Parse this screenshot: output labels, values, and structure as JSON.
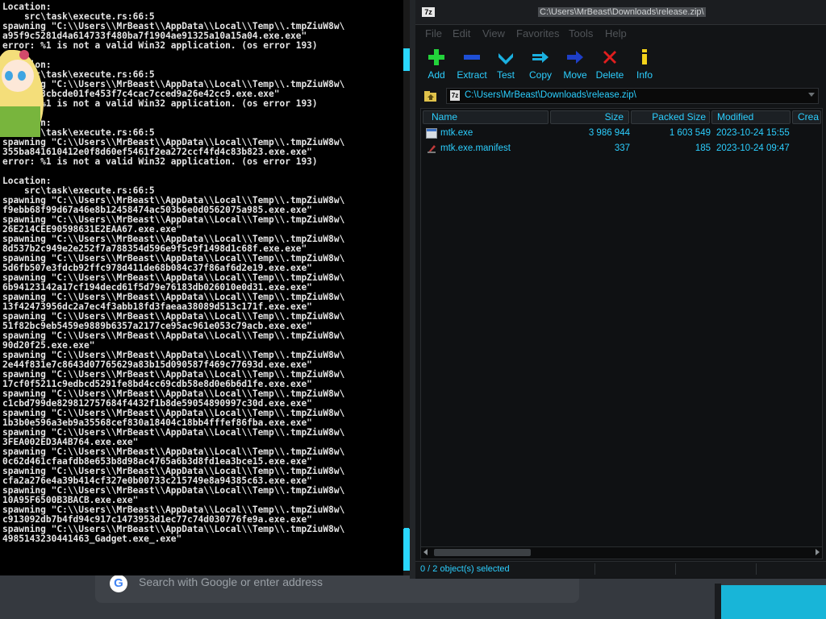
{
  "browser": {
    "search_placeholder": "Search with Google or enter address",
    "google_letter": "G"
  },
  "console": {
    "lines": [
      "Location:",
      "    src\\task\\execute.rs:66:5",
      "spawning \"C:\\\\Users\\\\MrBeast\\\\AppData\\\\Local\\\\Temp\\\\.tmpZiuW8w\\",
      "a95f9c5281d4a614733f480ba7f1904ae91325a10a15a04.exe.exe\"",
      "error: %1 is not a valid Win32 application. (os error 193)",
      "",
      "Location:",
      "    src\\task\\execute.rs:66:5",
      "spawning \"C:\\\\Users\\\\MrBeast\\\\AppData\\\\Local\\\\Temp\\\\.tmpZiuW8w\\",
      "b725a1c8cbcde01fe453f7c4cac7cced9a26e42cc9.exe.exe\"",
      "error: %1 is not a valid Win32 application. (os error 193)",
      "",
      "Location:",
      "    src\\task\\execute.rs:66:5",
      "spawning \"C:\\\\Users\\\\MrBeast\\\\AppData\\\\Local\\\\Temp\\\\.tmpZiuW8w\\",
      "355ba841610412e0f8d60ef5461f2ea272ccf4fd4c83b823.exe.exe\"",
      "error: %1 is not a valid Win32 application. (os error 193)",
      "",
      "Location:",
      "    src\\task\\execute.rs:66:5",
      "spawning \"C:\\\\Users\\\\MrBeast\\\\AppData\\\\Local\\\\Temp\\\\.tmpZiuW8w\\",
      "f9ebb68f99d67a46e8b12458474ac503b6e0d0562075a985.exe.exe\"",
      "spawning \"C:\\\\Users\\\\MrBeast\\\\AppData\\\\Local\\\\Temp\\\\.tmpZiuW8w\\",
      "26E214CEE90598631E2EAA67.exe.exe\"",
      "spawning \"C:\\\\Users\\\\MrBeast\\\\AppData\\\\Local\\\\Temp\\\\.tmpZiuW8w\\",
      "8d537b2c949e2e252f7a788354d596e9f5c9f1498d1c68f.exe.exe\"",
      "spawning \"C:\\\\Users\\\\MrBeast\\\\AppData\\\\Local\\\\Temp\\\\.tmpZiuW8w\\",
      "5d6fb507e3fdcb92ffc978d411de68b084c37f86af6d2e19.exe.exe\"",
      "spawning \"C:\\\\Users\\\\MrBeast\\\\AppData\\\\Local\\\\Temp\\\\.tmpZiuW8w\\",
      "6b94123142a17cf194decd61f5d79e76183db026010e0d31.exe.exe\"",
      "spawning \"C:\\\\Users\\\\MrBeast\\\\AppData\\\\Local\\\\Temp\\\\.tmpZiuW8w\\",
      "13f42473956dc2a7ec4f3abb18fd3faeaa38089d513c171f.exe.exe\"",
      "spawning \"C:\\\\Users\\\\MrBeast\\\\AppData\\\\Local\\\\Temp\\\\.tmpZiuW8w\\",
      "51f82bc9eb5459e9889b6357a2177ce95ac961e053c79acb.exe.exe\"",
      "spawning \"C:\\\\Users\\\\MrBeast\\\\AppData\\\\Local\\\\Temp\\\\.tmpZiuW8w\\",
      "90d20f25.exe.exe\"",
      "spawning \"C:\\\\Users\\\\MrBeast\\\\AppData\\\\Local\\\\Temp\\\\.tmpZiuW8w\\",
      "2e44f831e7c8643d07765629a83b15d090587f469c77693d.exe.exe\"",
      "spawning \"C:\\\\Users\\\\MrBeast\\\\AppData\\\\Local\\\\Temp\\\\.tmpZiuW8w\\",
      "17cf0f5211c9edbcd5291fe8bd4cc69cdb58e8d0e6b6d1fe.exe.exe\"",
      "spawning \"C:\\\\Users\\\\MrBeast\\\\AppData\\\\Local\\\\Temp\\\\.tmpZiuW8w\\",
      "c1cbd799de829812757684f4432f1b8de59054890997c30d.exe.exe\"",
      "spawning \"C:\\\\Users\\\\MrBeast\\\\AppData\\\\Local\\\\Temp\\\\.tmpZiuW8w\\",
      "1b3b0e596a3eb9a35568cef830a18404c18bb4fffef86fba.exe.exe\"",
      "spawning \"C:\\\\Users\\\\MrBeast\\\\AppData\\\\Local\\\\Temp\\\\.tmpZiuW8w\\",
      "3FEA002ED3A4B764.exe.exe\"",
      "spawning \"C:\\\\Users\\\\MrBeast\\\\AppData\\\\Local\\\\Temp\\\\.tmpZiuW8w\\",
      "0c62d461cfaafdb8e653b8d98ac4765a6b3d8fd1ea3bce15.exe.exe\"",
      "spawning \"C:\\\\Users\\\\MrBeast\\\\AppData\\\\Local\\\\Temp\\\\.tmpZiuW8w\\",
      "cfa2a276e4a39b414cf327e0b00733c215749e8a94385c63.exe.exe\"",
      "spawning \"C:\\\\Users\\\\MrBeast\\\\AppData\\\\Local\\\\Temp\\\\.tmpZiuW8w\\",
      "10A95F6500B3BACB.exe.exe\"",
      "spawning \"C:\\\\Users\\\\MrBeast\\\\AppData\\\\Local\\\\Temp\\\\.tmpZiuW8w\\",
      "c913092db7b4fd94c917c1473953d1ec77c74d030776fe9a.exe.exe\"",
      "spawning \"C:\\\\Users\\\\MrBeast\\\\AppData\\\\Local\\\\Temp\\\\.tmpZiuW8w\\",
      "4985143230441463_Gadget.exe_.exe\""
    ]
  },
  "zip": {
    "app_icon_text": "7z",
    "title": "C:\\Users\\MrBeast\\Downloads\\release.zip\\",
    "menu": [
      "File",
      "Edit",
      "View",
      "Favorites",
      "Tools",
      "Help"
    ],
    "toolbar": [
      {
        "label": "Add",
        "icon": "plus-icon",
        "color": "#22d33a"
      },
      {
        "label": "Extract",
        "icon": "minus-icon",
        "color": "#1e4fd6"
      },
      {
        "label": "Test",
        "icon": "checkmark-icon",
        "color": "#1ab0e0"
      },
      {
        "label": "Copy",
        "icon": "double-arrow-icon",
        "color": "#1ab0e0"
      },
      {
        "label": "Move",
        "icon": "arrow-right-icon",
        "color": "#1e3fc8"
      },
      {
        "label": "Delete",
        "icon": "x-icon",
        "color": "#e01e1e"
      },
      {
        "label": "Info",
        "icon": "info-icon",
        "color": "#f3d21a"
      }
    ],
    "address": "C:\\Users\\MrBeast\\Downloads\\release.zip\\",
    "columns": [
      "Name",
      "Size",
      "Packed Size",
      "Modified",
      "Crea"
    ],
    "files": [
      {
        "name": "mtk.exe",
        "size": "3 986 944",
        "packed": "1 603 549",
        "modified": "2023-10-24 15:55",
        "icon": "exe-file-icon"
      },
      {
        "name": "mtk.exe.manifest",
        "size": "337",
        "packed": "185",
        "modified": "2023-10-24 09:47",
        "icon": "manifest-file-icon"
      }
    ],
    "status": "0 / 2 object(s) selected",
    "accent": "#2ccfff"
  }
}
